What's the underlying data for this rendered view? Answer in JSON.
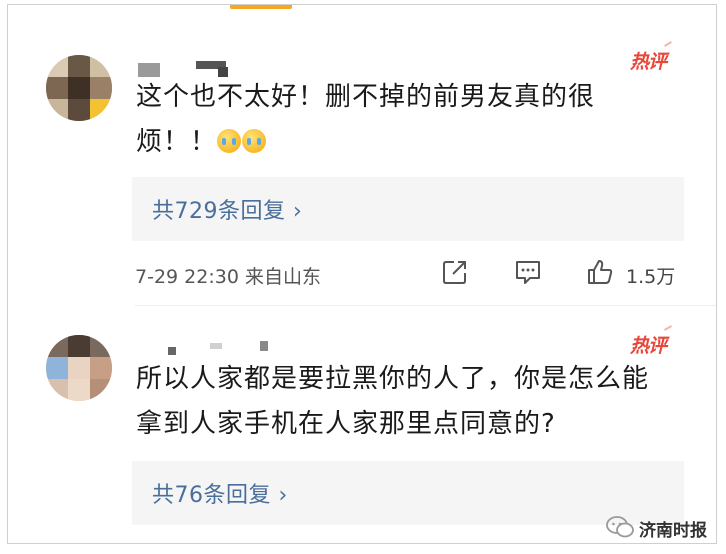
{
  "comments": [
    {
      "text_line1": "这个也不太好！删不掉的前男友真的很",
      "text_line2": "烦！！",
      "badge": "热评",
      "reply_label": "共729条回复 ›",
      "time_location": "7-29 22:30 来自山东",
      "likes": "1.5万",
      "emojis": [
        "crying-face-emoji",
        "crying-face-emoji"
      ]
    },
    {
      "text_line1": "所以人家都是要拉黑你的人了，你是怎么能",
      "text_line2": "拿到人家手机在人家那里点同意的?",
      "badge": "热评",
      "reply_label": "共76条回复 ›"
    }
  ],
  "watermark": {
    "text": "济南时报"
  },
  "colors": {
    "badge": "#e8473a",
    "reply_link": "#4a6e9c",
    "accent": "#f5a623"
  }
}
